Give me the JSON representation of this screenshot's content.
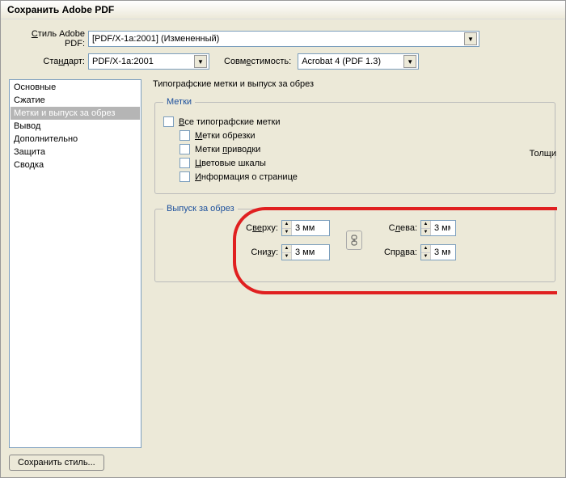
{
  "window": {
    "title": "Сохранить Adobe PDF"
  },
  "top": {
    "style_label": "Стиль Adobe PDF:",
    "style_underline": "С",
    "style_value": "[PDF/X-1a:2001] (Измененный)",
    "standard_label": "Стандарт:",
    "standard_underline": "н",
    "standard_value": "PDF/X-1a:2001",
    "compat_label": "Совместимость:",
    "compat_underline": "е",
    "compat_value": "Acrobat 4 (PDF 1.3)"
  },
  "sidebar": {
    "items": [
      "Основные",
      "Сжатие",
      "Метки и выпуск за обрез",
      "Вывод",
      "Дополнительно",
      "Защита",
      "Сводка"
    ],
    "selected": 2
  },
  "pane": {
    "title": "Типографские метки и выпуск за обрез",
    "marks_legend": "Метки",
    "all_marks": "Все типографские метки",
    "all_marks_u": "В",
    "trim": "Метки обрезки",
    "trim_u": "М",
    "reg": "Метки приводки",
    "reg_u": "п",
    "colorbars": "Цветовые шкалы",
    "colorbars_u": "Ц",
    "pageinfo": "Информация о странице",
    "pageinfo_u": "И",
    "thickness_label": "Толщи",
    "bleed_legend": "Выпуск за обрез",
    "top_label": "Сверху:",
    "top_u": "ве",
    "bottom_label": "Снизу:",
    "bottom_u": "з",
    "left_label": "Слева:",
    "left_u": "л",
    "right_label": "Справа:",
    "right_u": "а",
    "bleed_value": "3 мм"
  },
  "bottom": {
    "save_style": "Сохранить стиль..."
  }
}
